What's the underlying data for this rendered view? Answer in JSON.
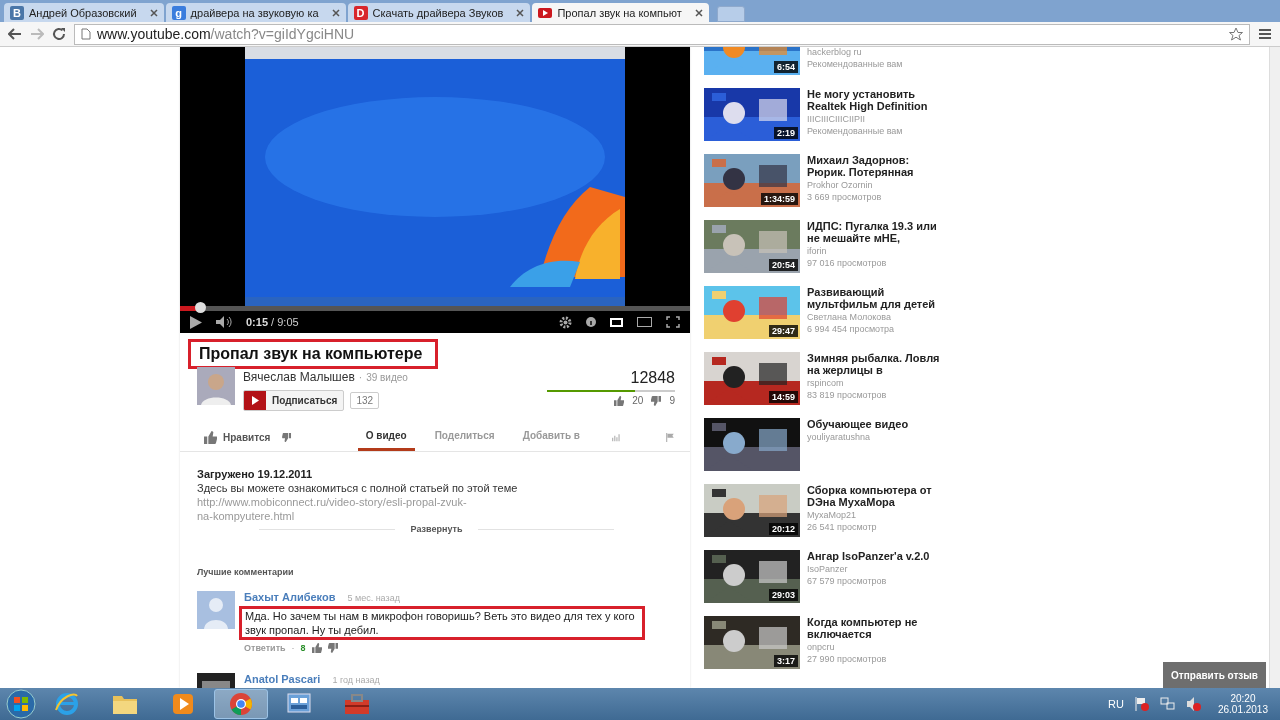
{
  "browser": {
    "tabs": [
      {
        "label": "Андрей Образовский",
        "favicon": "В",
        "color": "#4a76a8",
        "selected": false
      },
      {
        "label": "драйвера на звуковую ка",
        "favicon": "g",
        "color": "#3b7ddd",
        "selected": false
      },
      {
        "label": "Скачать драйвера Звуков",
        "favicon": "D",
        "color": "#d8262c",
        "selected": false
      },
      {
        "label": "Пропал звук на компьют",
        "color": "#cc181e",
        "selected": true
      }
    ],
    "url_host": "www.youtube.com",
    "url_path": "/watch?v=giIdYgciHNU",
    "back_disabled": false,
    "forward_disabled": true
  },
  "player": {
    "elapsed": "0:15",
    "duration": "/ 9:05",
    "level": 0.04
  },
  "video": {
    "title": "Пропал звук на компьютере",
    "highlighted": true,
    "channel": "Вячеслав Малышев",
    "separator": "·",
    "video_count": "39 видео",
    "subscribe": "Подписаться",
    "subscribers": "132",
    "views": "12848",
    "level": 0.69,
    "likes": "20",
    "dislikes": "9"
  },
  "actions": {
    "like": "Нравится",
    "tabs": [
      {
        "label": "О видео",
        "selected": true
      },
      {
        "label": "Поделиться",
        "selected": false
      },
      {
        "label": "Добавить в",
        "selected": false
      }
    ]
  },
  "description": {
    "uploaded": "Загружено 19.12.2011",
    "text": "Здесь вы можете ознакомиться с полной статьей по этой теме",
    "link": "http://www.mobiconnect.ru/video-story/esli-propal-zvuk-na-kompyutere.html",
    "expand": "Развернуть"
  },
  "comments": {
    "heading": "Лучшие комментарии",
    "items": [
      {
        "author": "Бахыт Алибеков",
        "time": "5 мес. назад",
        "text": "Мда. Но зачем ты нам в микрофон говоришь? Веть это видео для тех у кого звук пропал. Ну ты дебил.",
        "highlighted": true,
        "reply": "Ответить",
        "separator": "·",
        "likes": "8"
      },
      {
        "author": "Anatol Pascari",
        "time": "1 год назад"
      }
    ]
  },
  "sidebar": {
    "items": [
      {
        "channel": "hackerblog ru",
        "meta": "Рекомендованные вам",
        "duration": "6:54"
      },
      {
        "title": "Не могу установить Realtek High Definition",
        "channel": "IIICIIICIIICIIPII",
        "meta": "Рекомендованные вам",
        "duration": "2:19"
      },
      {
        "title": "Михаил Задорнов: Рюрик. Потерянная",
        "channel": "Prokhor Ozornin",
        "meta": "3 669 просмотров",
        "duration": "1:34:59"
      },
      {
        "title": "ИДПС: Пугалка 19.3 или не мешайте мНЕ,",
        "channel": "iforin",
        "meta": "97 016 просмотров",
        "duration": "20:54"
      },
      {
        "title": "Развивающий мультфильм для детей",
        "channel": "Светлана Молокова",
        "meta": "6 994 454 просмотра",
        "duration": "29:47"
      },
      {
        "title": "Зимняя рыбалка. Ловля на жерлицы в",
        "channel": "rspincom",
        "meta": "83 819 просмотров",
        "duration": "14:59"
      },
      {
        "title": "Обучающее видео",
        "channel": "youliyaratushna"
      },
      {
        "title": "Сборка компьютера от DЭна МухаМора",
        "channel": "МухаMop21",
        "meta": "26 541 просмотр",
        "duration": "20:12"
      },
      {
        "title": "Ангар IsoPanzer'a v.2.0",
        "channel": "IsoPanzer",
        "meta": "67 579 просмотров",
        "duration": "29:03"
      },
      {
        "title": "Когда компьютер не включается",
        "channel": "onpcru",
        "meta": "27 990 просмотров",
        "duration": "3:17"
      }
    ]
  },
  "feedback": "Отправить отзыв",
  "taskbar": {
    "apps": [
      {
        "kind": "ie",
        "selected": false
      },
      {
        "kind": "folder",
        "selected": false
      },
      {
        "kind": "media",
        "selected": false
      },
      {
        "kind": "chrome",
        "selected": true
      },
      {
        "kind": "window",
        "selected": false
      },
      {
        "kind": "toolbox",
        "selected": false
      }
    ],
    "language": "RU",
    "time": "20:20",
    "date": "26.01.2013"
  }
}
